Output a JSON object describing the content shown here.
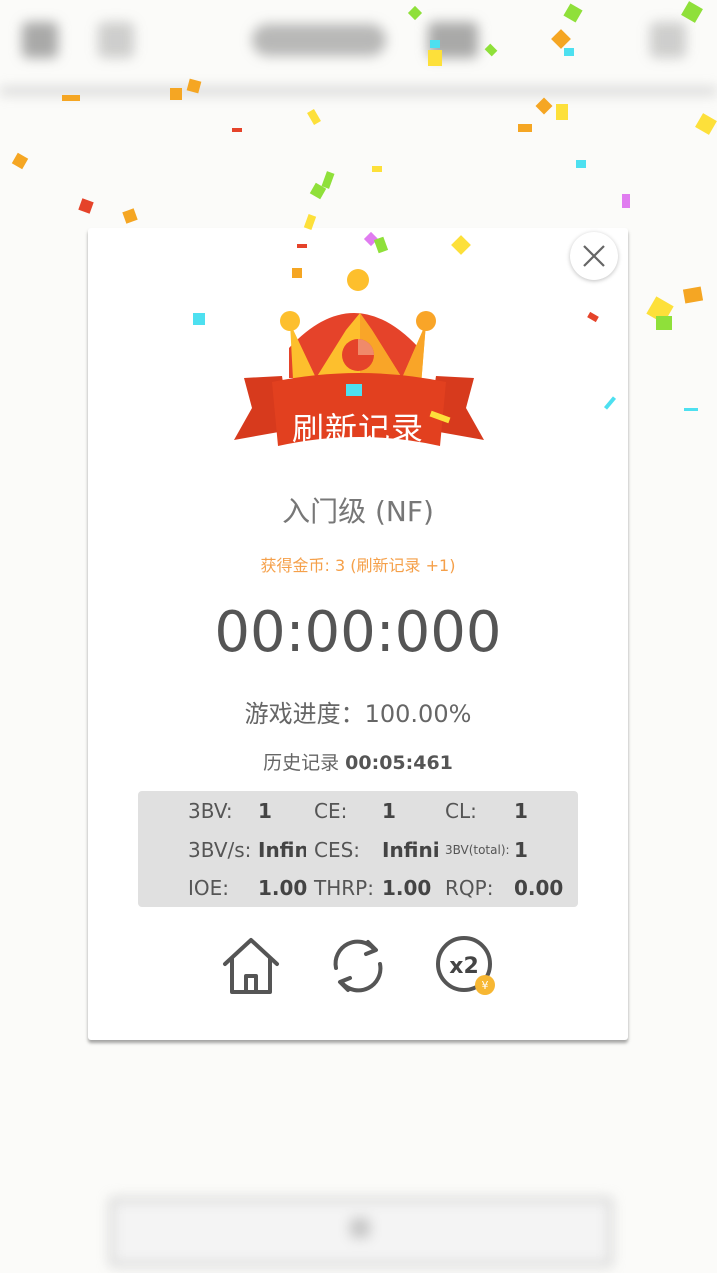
{
  "dialog": {
    "banner": "刷新记录",
    "level": "入门级 (NF)",
    "coins": "获得金币: 3 (刷新记录 +1)",
    "timer": "00:00:000",
    "progress": "游戏进度：100.00%",
    "history_label": "历史记录",
    "history_value": "00:05:461"
  },
  "stats": {
    "bv_label": "3BV:",
    "bv_value": "1",
    "ce_label": "CE:",
    "ce_value": "1",
    "cl_label": "CL:",
    "cl_value": "1",
    "bvs_label": "3BV/s:",
    "bvs_value": "Infini",
    "ces_label": "CES:",
    "ces_value": "Infinit",
    "bvtotal_label": "3BV(total):",
    "bvtotal_value": "1",
    "ioe_label": "IOE:",
    "ioe_value": "1.00",
    "thrp_label": "THRP:",
    "thrp_value": "1.00",
    "rqp_label": "RQP:",
    "rqp_value": "0.00"
  },
  "actions": {
    "home_icon": "home-icon",
    "restart_icon": "restart-icon",
    "double_icon": "double-reward-icon",
    "double_label": "x2",
    "coin_symbol": "¥"
  },
  "colors": {
    "banner_red": "#e2401f",
    "crown_yellow": "#fdbf2d",
    "coin_text": "#f5a04a",
    "stats_bg": "#e0e0e0"
  }
}
